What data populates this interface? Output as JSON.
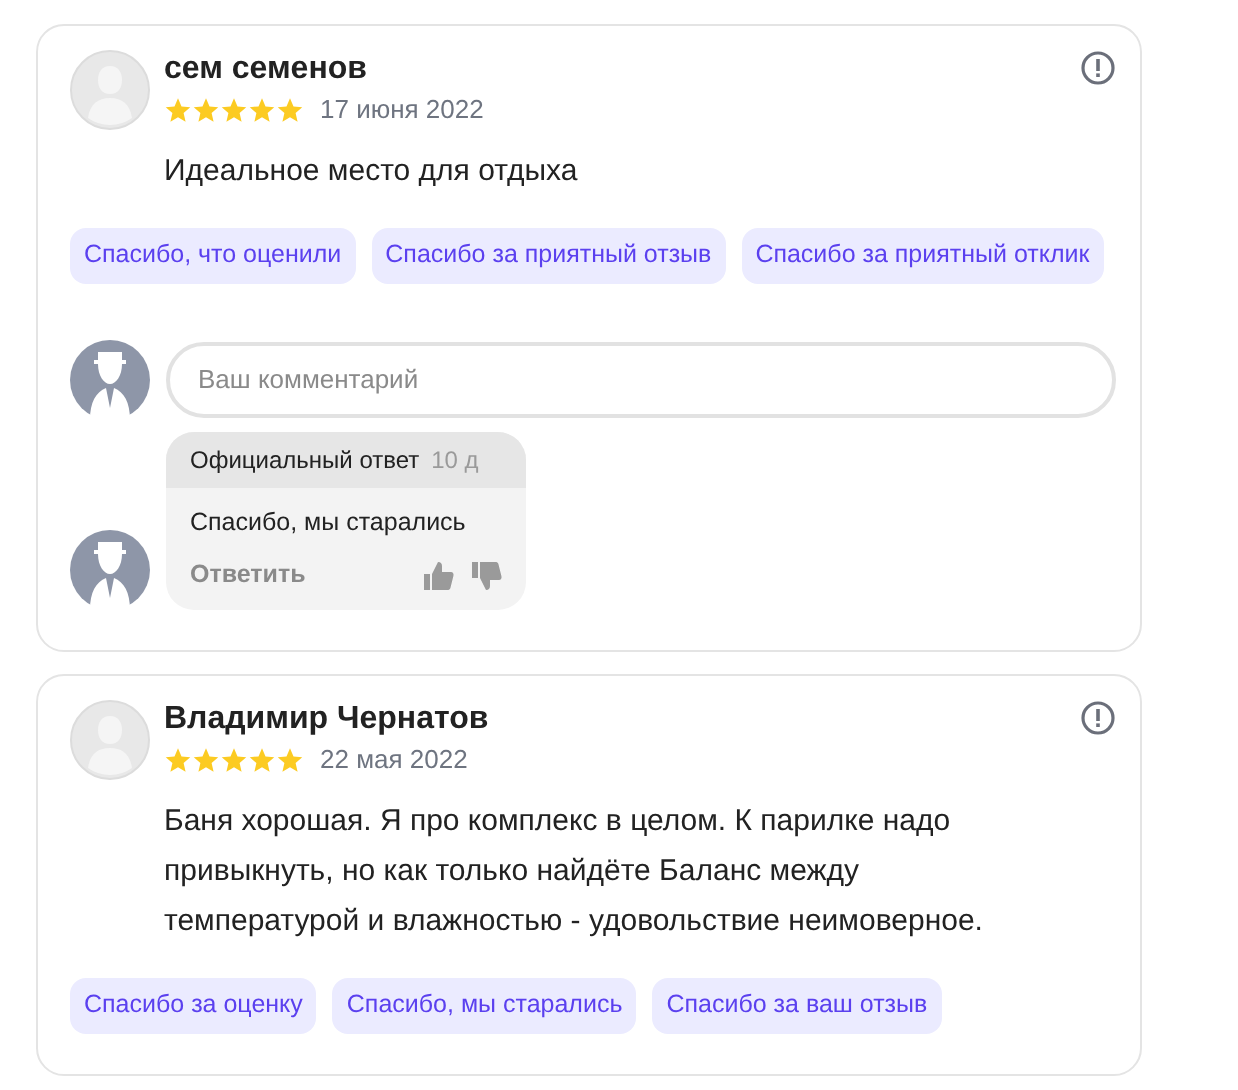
{
  "reviews": [
    {
      "author": "сем семенов",
      "stars": 5,
      "date": "17 июня 2022",
      "text": "Идеальное место для отдыха",
      "quick_replies": [
        "Спасибо, что оценили",
        "Спасибо за приятный отзыв",
        "Спасибо за приятный отклик"
      ],
      "comment": {
        "placeholder": "Ваш комментарий"
      },
      "official_reply": {
        "label": "Официальный ответ",
        "age": "10 д",
        "text": "Спасибо, мы старались",
        "reply_link": "Ответить"
      }
    },
    {
      "author": "Владимир Чернатов",
      "stars": 5,
      "date": "22 мая 2022",
      "text": "Баня хорошая. Я про комплекс в целом. К парилке надо привыкнуть, но как только найдёте Баланс между температурой и влажностью - удовольствие неимоверное.",
      "quick_replies": [
        "Спасибо за оценку",
        "Спасибо, мы старались",
        "Спасибо за ваш отзыв"
      ]
    }
  ]
}
